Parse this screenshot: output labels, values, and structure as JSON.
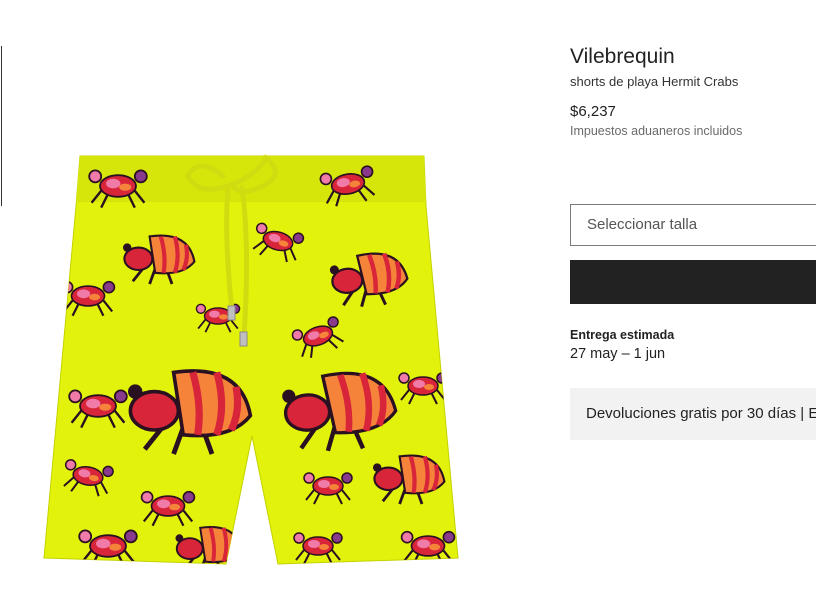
{
  "product": {
    "brand": "Vilebrequin",
    "name": "shorts de playa Hermit Crabs",
    "price": "$6,237",
    "duties_note": "Impuestos aduaneros incluidos"
  },
  "size_select": {
    "placeholder": "Seleccionar talla"
  },
  "add_button": {
    "label": ""
  },
  "delivery": {
    "label": "Entrega estimada",
    "dates": "27 may – 1 jun"
  },
  "returns": {
    "text": "Devoluciones gratis por 30 días | E"
  },
  "colors": {
    "shorts_base": "#e2f20a",
    "crab_red": "#d8253a",
    "crab_pink": "#f07aa8",
    "crab_orange": "#f5843a",
    "crab_purple": "#8a3a8c",
    "button_dark": "#222222"
  }
}
